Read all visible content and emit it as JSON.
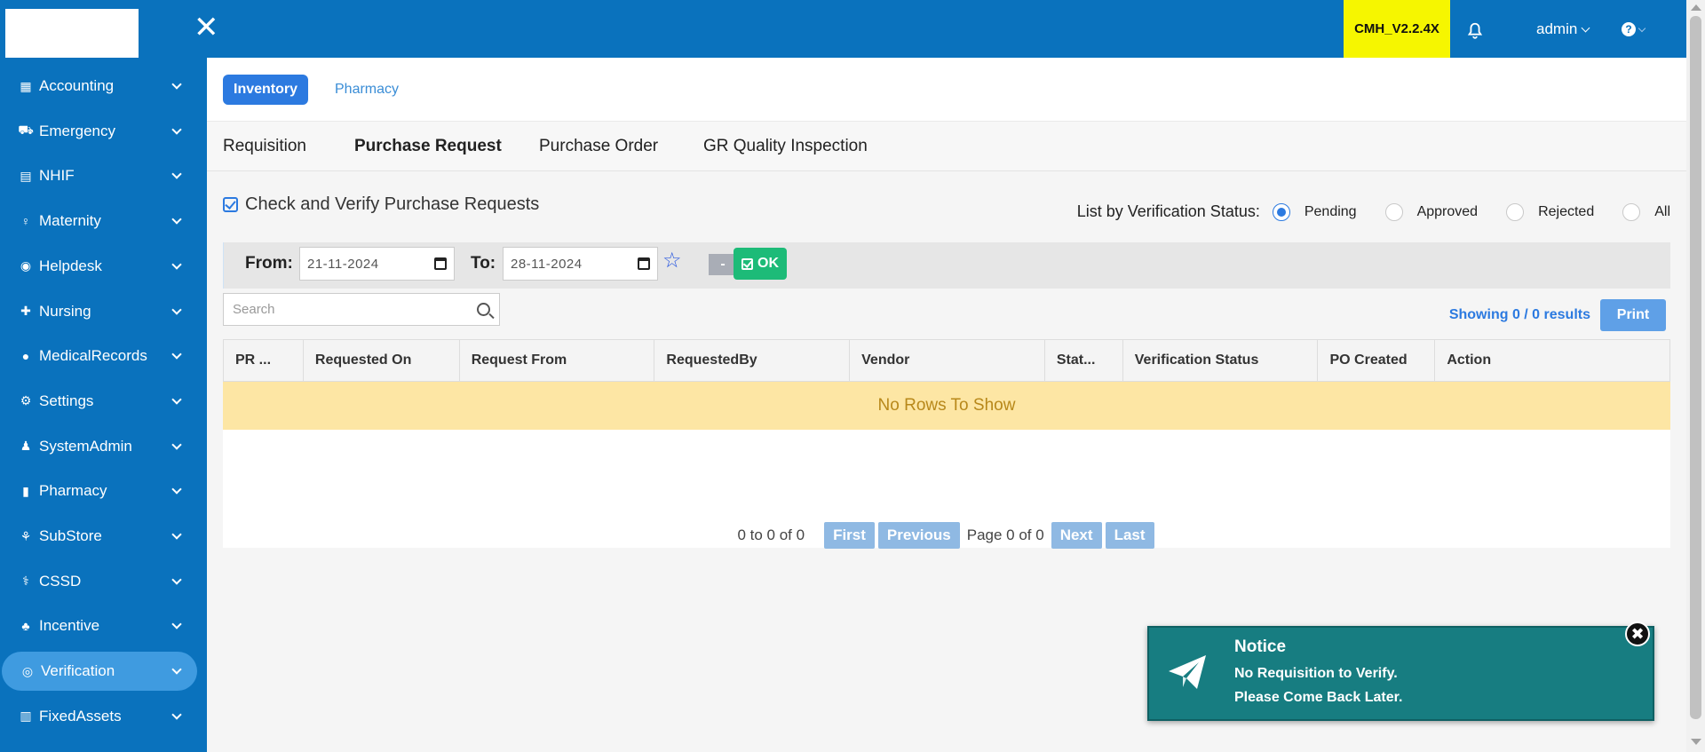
{
  "topbar": {
    "version": "CMH_V2.2.4X",
    "user": "admin",
    "close_glyph": "✕",
    "help_glyph": "?"
  },
  "sidebar": {
    "items": [
      {
        "label": "Accounting",
        "icon": "building-icon"
      },
      {
        "label": "Emergency",
        "icon": "ambulance-icon"
      },
      {
        "label": "NHIF",
        "icon": "id-card-icon"
      },
      {
        "label": "Maternity",
        "icon": "maternity-icon"
      },
      {
        "label": "Helpdesk",
        "icon": "helpdesk-icon"
      },
      {
        "label": "Nursing",
        "icon": "nursing-icon"
      },
      {
        "label": "MedicalRecords",
        "icon": "records-icon"
      },
      {
        "label": "Settings",
        "icon": "gear-icon"
      },
      {
        "label": "SystemAdmin",
        "icon": "admin-icon"
      },
      {
        "label": "Pharmacy",
        "icon": "pill-icon"
      },
      {
        "label": "SubStore",
        "icon": "store-icon"
      },
      {
        "label": "CSSD",
        "icon": "cssd-icon"
      },
      {
        "label": "Incentive",
        "icon": "incentive-icon"
      },
      {
        "label": "Verification",
        "icon": "verify-icon",
        "active": true
      },
      {
        "label": "FixedAssets",
        "icon": "assets-icon"
      }
    ]
  },
  "module_tabs": [
    {
      "label": "Inventory",
      "active": true
    },
    {
      "label": "Pharmacy",
      "active": false
    }
  ],
  "sub_tabs": [
    {
      "label": "Requisition",
      "active": false
    },
    {
      "label": "Purchase Request",
      "active": true
    },
    {
      "label": "Purchase Order",
      "active": false
    },
    {
      "label": "GR Quality Inspection",
      "active": false
    }
  ],
  "page": {
    "title": "Check and Verify Purchase Requests",
    "status_label": "List by Verification Status:",
    "status_options": [
      "Pending",
      "Approved",
      "Rejected",
      "All"
    ],
    "status_selected": "Pending"
  },
  "filter": {
    "from_label": "From:",
    "from_value": "21-11-2024",
    "to_label": "To:",
    "to_value": "28-11-2024",
    "minus_label": "-",
    "ok_label": "OK"
  },
  "search": {
    "placeholder": "Search"
  },
  "results": {
    "showing_prefix": "Showing",
    "showing_count": "0 / 0",
    "showing_suffix": "results",
    "print_label": "Print"
  },
  "table": {
    "columns": [
      "PR ...",
      "Requested On",
      "Request From",
      "RequestedBy",
      "Vendor",
      "Stat...",
      "Verification Status",
      "PO Created",
      "Action"
    ],
    "empty_text": "No Rows To Show"
  },
  "pager": {
    "range": "0 to 0 of 0",
    "first": "First",
    "previous": "Previous",
    "page_info": "Page 0 of 0",
    "next": "Next",
    "last": "Last"
  },
  "notice": {
    "title": "Notice",
    "line1": "No Requisition to Verify.",
    "line2": "Please Come Back Later.",
    "close_glyph": "✖"
  },
  "colors": {
    "brand_blue": "#0a72bd",
    "version_bg": "#f6f600",
    "ok_green": "#1dbb78",
    "notice_teal": "#177d81",
    "empty_row_bg": "#fde6a4"
  }
}
